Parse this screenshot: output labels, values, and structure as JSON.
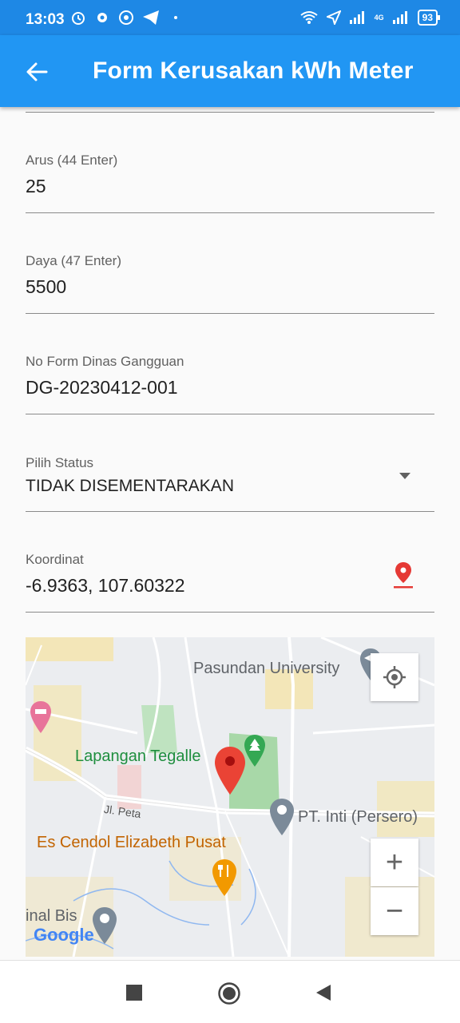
{
  "status_bar": {
    "time": "13:03",
    "network": "4G",
    "battery": "93"
  },
  "app_bar": {
    "title": "Form Kerusakan kWh Meter"
  },
  "form": {
    "arus": {
      "label": "Arus (44 Enter)",
      "value": "25"
    },
    "daya": {
      "label": "Daya (47 Enter)",
      "value": "5500"
    },
    "no_form": {
      "label": "No Form Dinas Gangguan",
      "value": "DG-20230412-001"
    },
    "status": {
      "label": "Pilih Status",
      "value": "TIDAK DISEMENTARAKAN"
    },
    "koordinat": {
      "label": "Koordinat",
      "value": "-6.9363, 107.60322"
    }
  },
  "map": {
    "labels": {
      "pasundan": "Pasundan University",
      "lapangan": "Lapangan Tegalle",
      "jl_peta": "Jl. Peta",
      "pt_inti": "PT. Inti (Persero)",
      "es_cendol": "Es Cendol Elizabeth Pusat",
      "terminal": "inal Bis",
      "google": "Google"
    },
    "zoom_in": "+",
    "zoom_out": "−"
  },
  "colors": {
    "app_bar": "#2196f3",
    "status_bar": "#1e88e5",
    "pin_red": "#e53935"
  }
}
